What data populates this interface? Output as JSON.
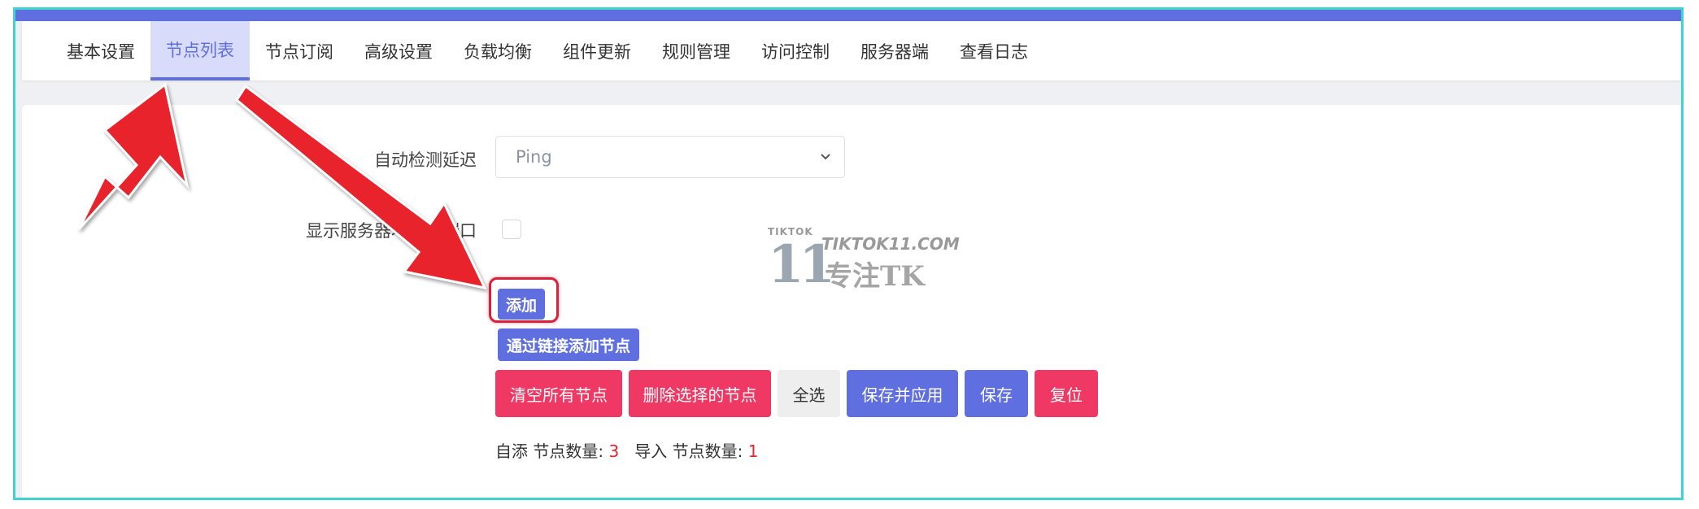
{
  "tabs": [
    {
      "label": "基本设置",
      "active": false
    },
    {
      "label": "节点列表",
      "active": true
    },
    {
      "label": "节点订阅",
      "active": false
    },
    {
      "label": "高级设置",
      "active": false
    },
    {
      "label": "负载均衡",
      "active": false
    },
    {
      "label": "组件更新",
      "active": false
    },
    {
      "label": "规则管理",
      "active": false
    },
    {
      "label": "访问控制",
      "active": false
    },
    {
      "label": "服务器端",
      "active": false
    },
    {
      "label": "查看日志",
      "active": false
    }
  ],
  "form": {
    "auto_detect_latency_label": "自动检测延迟",
    "auto_detect_latency_value": "Ping",
    "show_server_address_label": "显示服务器地址和端口"
  },
  "buttons": {
    "add": "添加",
    "add_via_link": "通过链接添加节点",
    "clear_all": "清空所有节点",
    "delete_selected": "删除选择的节点",
    "select_all": "全选",
    "save_apply": "保存并应用",
    "save": "保存",
    "reset": "复位"
  },
  "counts": {
    "self_added_label": "自添 节点数量:",
    "self_added_value": "3",
    "imported_label": "导入 节点数量:",
    "imported_value": "1"
  },
  "watermark": {
    "small": "TIKTOK",
    "number": "11",
    "site": "TIKTOK11.COM",
    "tagline": "专注TK"
  },
  "colors": {
    "accent": "#5f6fe0",
    "danger": "#ef3863",
    "frame_border": "#3fd3d1",
    "annotation": "#e8232c"
  }
}
